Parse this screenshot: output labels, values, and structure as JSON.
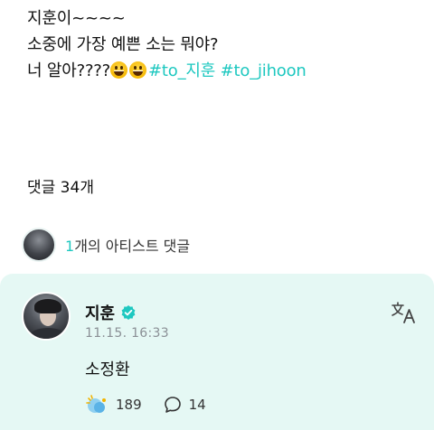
{
  "post": {
    "line1": "지훈이~~~~",
    "line2": "소중에 가장 예쁜 소는 뭐야?",
    "line3_text": "너 알아????",
    "emojis": [
      "grinning-face-emoji",
      "grinning-face-emoji"
    ],
    "hashtag1": "#to_지훈",
    "hashtag2": "#to_jihoon"
  },
  "comments": {
    "count_label": "댓글 34개"
  },
  "artist_comments": {
    "count": "1",
    "label": "개의 아티스트 댓글"
  },
  "artist_comment": {
    "author": "지훈",
    "timestamp": "11.15. 16:33",
    "body": "소정환",
    "likes": "189",
    "replies": "14"
  },
  "colors": {
    "accent": "#1ec8c0",
    "card_bg": "#e5f8f4",
    "timestamp": "#8a8f95"
  },
  "icons": [
    "verified-badge-icon",
    "translate-icon",
    "like-icon",
    "comment-bubble-icon"
  ]
}
